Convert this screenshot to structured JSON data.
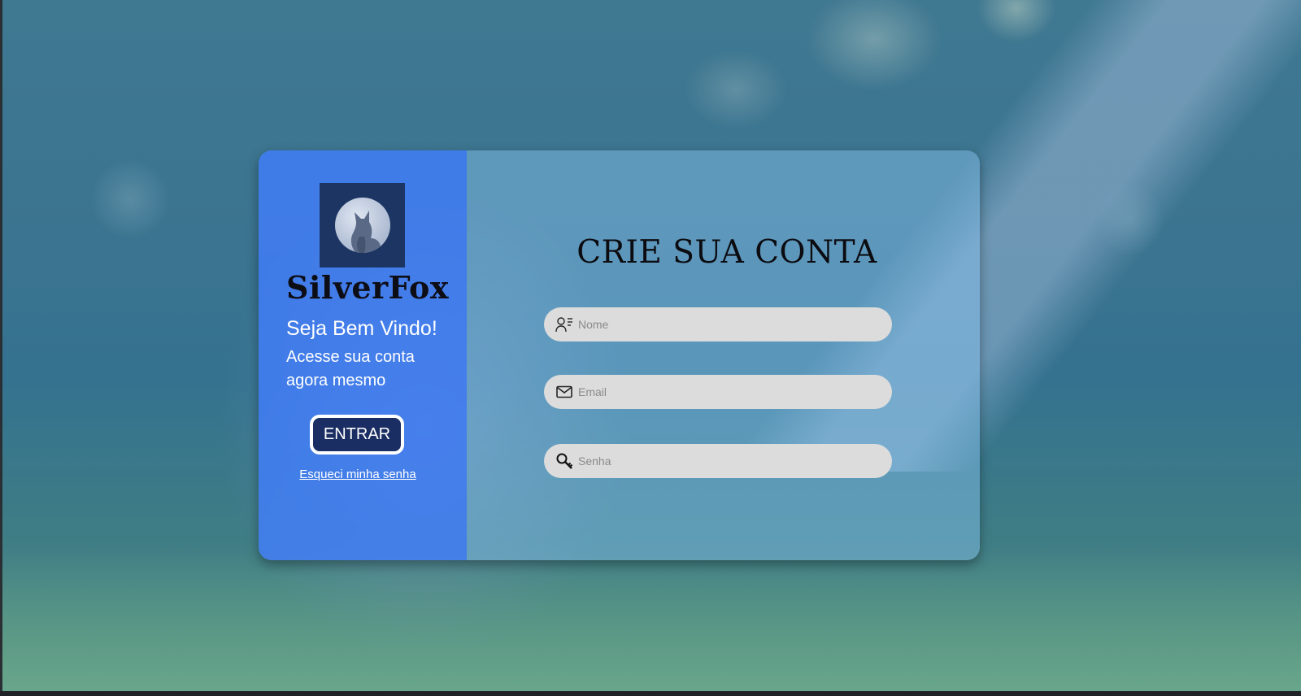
{
  "brand": {
    "name": "SilverFox",
    "logo_icon": "fox-logo-icon"
  },
  "welcome_panel": {
    "greeting": "Seja Bem Vindo!",
    "subtitle": "Acesse sua conta agora mesmo",
    "login_button_label": "ENTRAR",
    "forgot_password_link": "Esqueci  minha senha"
  },
  "signup_form": {
    "title": "CRIE SUA CONTA",
    "fields": {
      "name": {
        "placeholder": "Nome",
        "icon": "user-card-icon",
        "value": ""
      },
      "email": {
        "placeholder": "Email",
        "icon": "mail-icon",
        "value": ""
      },
      "password": {
        "placeholder": "Senha",
        "icon": "key-icon",
        "value": ""
      }
    }
  },
  "colors": {
    "left_panel": "#417dff",
    "button_bg": "#1a2e63",
    "logo_bg": "#1c3563",
    "input_bg": "#dcdcdc"
  }
}
